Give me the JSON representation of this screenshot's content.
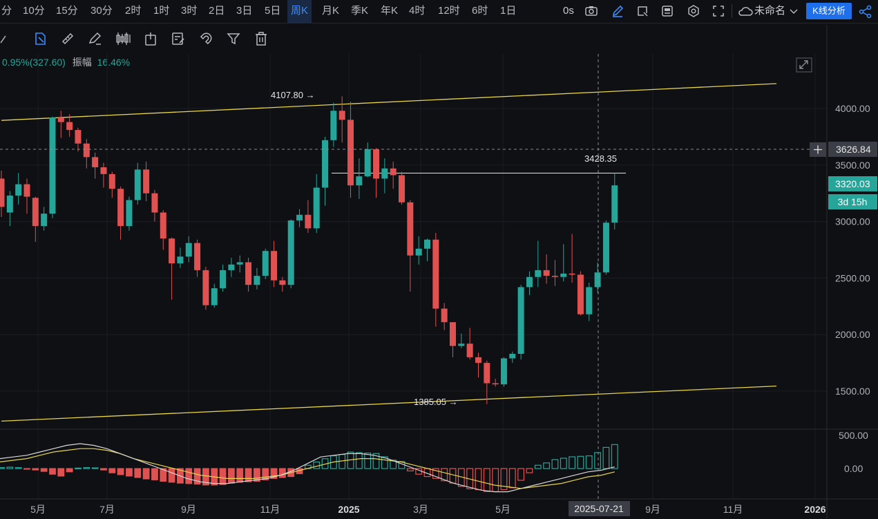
{
  "toolbar": {
    "timeframes": [
      "分",
      "10分",
      "15分",
      "30分",
      "2时",
      "1时",
      "3时",
      "2日",
      "3日",
      "5日",
      "周K",
      "月K",
      "季K",
      "年K",
      "4时",
      "12时",
      "6时",
      "1日"
    ],
    "active_timeframe": "周K",
    "countdown_label": "0s",
    "layout_name": "未命名",
    "analysis_button": "K线分析"
  },
  "stats": {
    "change": "0.95%(327.60)",
    "amplitude_label": "振幅",
    "amplitude_value": "16.46%"
  },
  "colors": {
    "up": "#26a69a",
    "down": "#e05252",
    "trend": "#e8d44d",
    "accent": "#1f6fea"
  },
  "chart_data": {
    "type": "candlestick",
    "price_axis": {
      "ticks": [
        "4000.00",
        "3500.00",
        "3000.00",
        "2500.00",
        "2000.00",
        "1500.00"
      ],
      "range": [
        1225,
        4300
      ]
    },
    "indicator_axis": {
      "ticks": [
        "500.00",
        "0.00"
      ]
    },
    "time_axis": [
      "5月",
      "7月",
      "9月",
      "11月",
      "2025",
      "3月",
      "5月",
      "9月",
      "11月",
      "2026"
    ],
    "crosshair": {
      "date": "2025-07-21",
      "price": "3626.84"
    },
    "current_price": "3320.03",
    "countdown": "3d 15h",
    "annotations": {
      "high": "4107.80 →",
      "low": "1385.05 →",
      "level": "3428.35"
    },
    "trendlines": [
      {
        "from": [
          0,
          3895
        ],
        "to": [
          91,
          4220
        ]
      },
      {
        "from": [
          0,
          1235
        ],
        "to": [
          91,
          1545
        ]
      }
    ],
    "horizontal_level": 3428.35,
    "candles": [
      [
        3380,
        3130,
        3450,
        3040
      ],
      [
        3080,
        3230,
        3270,
        2960
      ],
      [
        3230,
        3330,
        3430,
        3150
      ],
      [
        3330,
        3220,
        3380,
        3070
      ],
      [
        3210,
        2960,
        3220,
        2820
      ],
      [
        2960,
        3070,
        3130,
        2920
      ],
      [
        3070,
        3920,
        3930,
        3030
      ],
      [
        3920,
        3880,
        3980,
        3740
      ],
      [
        3880,
        3810,
        3950,
        3750
      ],
      [
        3810,
        3690,
        3830,
        3620
      ],
      [
        3690,
        3570,
        3730,
        3470
      ],
      [
        3570,
        3480,
        3610,
        3380
      ],
      [
        3480,
        3420,
        3520,
        3300
      ],
      [
        3420,
        3290,
        3440,
        3210
      ],
      [
        3290,
        2960,
        3310,
        2840
      ],
      [
        2960,
        3190,
        3220,
        2920
      ],
      [
        3190,
        3460,
        3520,
        3150
      ],
      [
        3460,
        3250,
        3530,
        3180
      ],
      [
        3250,
        3080,
        3280,
        3000
      ],
      [
        3080,
        2850,
        3100,
        2750
      ],
      [
        2850,
        2630,
        2860,
        2310
      ],
      [
        2630,
        2690,
        2770,
        2590
      ],
      [
        2690,
        2810,
        2870,
        2640
      ],
      [
        2810,
        2570,
        2840,
        2510
      ],
      [
        2570,
        2260,
        2600,
        2220
      ],
      [
        2260,
        2410,
        2450,
        2240
      ],
      [
        2410,
        2570,
        2620,
        2380
      ],
      [
        2570,
        2620,
        2680,
        2510
      ],
      [
        2620,
        2640,
        2700,
        2550
      ],
      [
        2640,
        2440,
        2680,
        2380
      ],
      [
        2440,
        2520,
        2590,
        2400
      ],
      [
        2520,
        2740,
        2760,
        2490
      ],
      [
        2740,
        2480,
        2830,
        2420
      ],
      [
        2480,
        2440,
        2510,
        2380
      ],
      [
        2440,
        3010,
        3020,
        2410
      ],
      [
        3010,
        3060,
        3110,
        2950
      ],
      [
        3060,
        2940,
        3190,
        2900
      ],
      [
        2940,
        3300,
        3420,
        2900
      ],
      [
        3300,
        3720,
        3750,
        3140
      ],
      [
        3720,
        3980,
        4050,
        3660
      ],
      [
        3980,
        3900,
        4107.8,
        3700
      ],
      [
        3900,
        3320,
        4060,
        3210
      ],
      [
        3320,
        3400,
        3560,
        3200
      ],
      [
        3400,
        3640,
        3700,
        3390
      ],
      [
        3640,
        3380,
        3650,
        3210
      ],
      [
        3380,
        3470,
        3560,
        3250
      ],
      [
        3470,
        3410,
        3530,
        3290
      ],
      [
        3410,
        3170,
        3440,
        3150
      ],
      [
        3170,
        2700,
        3190,
        2380
      ],
      [
        2700,
        2760,
        2870,
        2620
      ],
      [
        2760,
        2840,
        2850,
        2650
      ],
      [
        2840,
        2230,
        2900,
        2070
      ],
      [
        2230,
        2110,
        2280,
        2040
      ],
      [
        2110,
        1900,
        2100,
        1800
      ],
      [
        1900,
        1920,
        2010,
        1880
      ],
      [
        1920,
        1800,
        2060,
        1780
      ],
      [
        1800,
        1750,
        1840,
        1620
      ],
      [
        1750,
        1570,
        1770,
        1385.05
      ],
      [
        1570,
        1560,
        1610,
        1540
      ],
      [
        1560,
        1790,
        1800,
        1540
      ],
      [
        1790,
        1830,
        1850,
        1750
      ],
      [
        1830,
        2420,
        2440,
        1780
      ],
      [
        2420,
        2510,
        2560,
        2350
      ],
      [
        2510,
        2570,
        2830,
        2420
      ],
      [
        2570,
        2520,
        2710,
        2450
      ],
      [
        2520,
        2510,
        2660,
        2430
      ],
      [
        2510,
        2540,
        2800,
        2470
      ],
      [
        2540,
        2530,
        2890,
        2460
      ],
      [
        2530,
        2180,
        2560,
        2170
      ],
      [
        2180,
        2420,
        2460,
        2120
      ],
      [
        2420,
        2550,
        2640,
        2370
      ],
      [
        2550,
        2990,
        3010,
        2530
      ],
      [
        2990,
        3320.03,
        3428.35,
        2930
      ]
    ],
    "macd": {
      "histogram": [
        8,
        12,
        8,
        -4,
        -12,
        -24,
        -48,
        -64,
        -28,
        4,
        8,
        6,
        -12,
        -36,
        -52,
        -64,
        -76,
        -88,
        -96,
        -108,
        -116,
        -124,
        -128,
        -132,
        -140,
        -140,
        -136,
        -124,
        -116,
        -112,
        -108,
        -96,
        -84,
        -76,
        -68,
        -44,
        28,
        56,
        84,
        108,
        120,
        140,
        136,
        132,
        128,
        100,
        72,
        60,
        -20,
        -48,
        -68,
        -84,
        -104,
        -124,
        -152,
        -172,
        -180,
        -196,
        -196,
        -180,
        -164,
        -100,
        -36,
        28,
        48,
        76,
        88,
        100,
        104,
        108,
        136,
        180,
        204
      ],
      "macd_line": [
        0.6,
        0.7,
        0.8,
        1.0,
        1.2,
        1.4,
        1.5,
        1.4,
        1.2,
        0.9,
        0.6,
        0.3,
        0.0,
        -0.3,
        -0.6,
        -0.8,
        -0.9,
        -0.9,
        -0.8,
        -0.7,
        -0.6,
        -0.4,
        -0.1,
        0.3,
        0.7,
        0.8,
        0.9,
        0.9,
        0.8,
        0.6,
        0.3,
        0.0,
        -0.3,
        -0.6,
        -0.9,
        -1.1,
        -1.3,
        -1.4,
        -1.4,
        -1.2,
        -1.0,
        -0.8,
        -0.6,
        -0.4,
        -0.2,
        -0.1,
        0.1
      ],
      "signal_line": [
        0.4,
        0.5,
        0.6,
        0.8,
        1.0,
        1.1,
        1.2,
        1.2,
        1.1,
        0.9,
        0.6,
        0.4,
        0.2,
        0.0,
        -0.2,
        -0.4,
        -0.5,
        -0.6,
        -0.6,
        -0.6,
        -0.5,
        -0.4,
        -0.2,
        0.0,
        0.2,
        0.4,
        0.5,
        0.6,
        0.6,
        0.5,
        0.4,
        0.2,
        0.0,
        -0.2,
        -0.4,
        -0.6,
        -0.8,
        -1.0,
        -1.1,
        -1.2,
        -1.1,
        -1.0,
        -0.9,
        -0.7,
        -0.5,
        -0.4,
        -0.2
      ]
    }
  }
}
